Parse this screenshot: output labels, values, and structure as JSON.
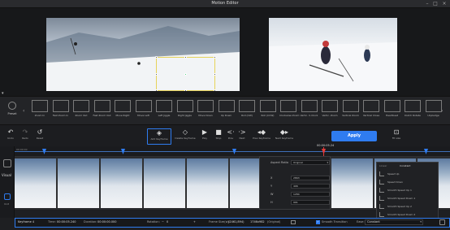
{
  "window": {
    "title": "Motion Editor"
  },
  "preset": {
    "label": "Preset"
  },
  "presets": [
    {
      "label": "Zoom In"
    },
    {
      "label": "Fast Zoom In"
    },
    {
      "label": "Zoom Out"
    },
    {
      "label": "Fast Zoom Out"
    },
    {
      "label": "Move Right"
    },
    {
      "label": "Move Left"
    },
    {
      "label": "Left Jiggle"
    },
    {
      "label": "Right Jiggle"
    },
    {
      "label": "Move Down"
    },
    {
      "label": "Up Down"
    },
    {
      "label": "Roll (CW)"
    },
    {
      "label": "Roll (CCW)"
    },
    {
      "label": "Clockwise Zoom"
    },
    {
      "label": "Vertic. C-Clock"
    },
    {
      "label": "Vertic. Zoom"
    },
    {
      "label": "Vertical Zoom"
    },
    {
      "label": "Vertical Close"
    },
    {
      "label": "Heartbeat"
    },
    {
      "label": "Dutch Rotate"
    },
    {
      "label": "Unpledge"
    }
  ],
  "toolbar": {
    "undo": "Undo",
    "redo": "Redo",
    "reset": "Reset",
    "add_keyframe": "Add Keyframe",
    "delete_keyframe": "Delete Keyframe",
    "play": "Play",
    "stop": "Stop",
    "prev": "Prev",
    "next": "Next",
    "prev_keyframe": "Prev Keyframe",
    "next_keyframe": "Next Keyframe",
    "apply": "Apply",
    "fit_size": "Fit size"
  },
  "timeline": {
    "time_left": "00:00:00",
    "playhead_time": "00:00:05.24",
    "side_visual": "Visual",
    "side_unit": "Unit"
  },
  "aspect_panel": {
    "ratio_label": "Aspect Ratio",
    "ratio_value": "Original",
    "x_label": "X",
    "x_value": "2863",
    "y_label": "Y",
    "y_value": "496",
    "w_label": "W",
    "w_value": "1284",
    "h_label": "H",
    "h_value": "991"
  },
  "easing": {
    "header_left": "Linear",
    "header_right": "Constant",
    "items": [
      {
        "label": "Speed Up"
      },
      {
        "label": "Speed Down"
      },
      {
        "label": "Smooth Speed Up 1"
      },
      {
        "label": "Smooth Speed Down 1"
      },
      {
        "label": "Smooth Speed Up 2"
      },
      {
        "label": "Smooth Speed Down 2"
      }
    ]
  },
  "statusbar": {
    "keyframe": "Keyframe 4",
    "time_label": "Time:",
    "time_value": "00:00:05.240",
    "duration_label": "Duration:",
    "duration_value": "00:00:00.000",
    "rotation_label": "Rotation:",
    "rotation_value": "0",
    "frame_label": "Frame Size(w):",
    "frame_value": "(2461,894)",
    "frame_value2": "1746x982",
    "frame_suffix": "(Original)",
    "smooth_label": "Smooth Transition",
    "ease_label": "Ease:",
    "ease_value": "Constant"
  }
}
